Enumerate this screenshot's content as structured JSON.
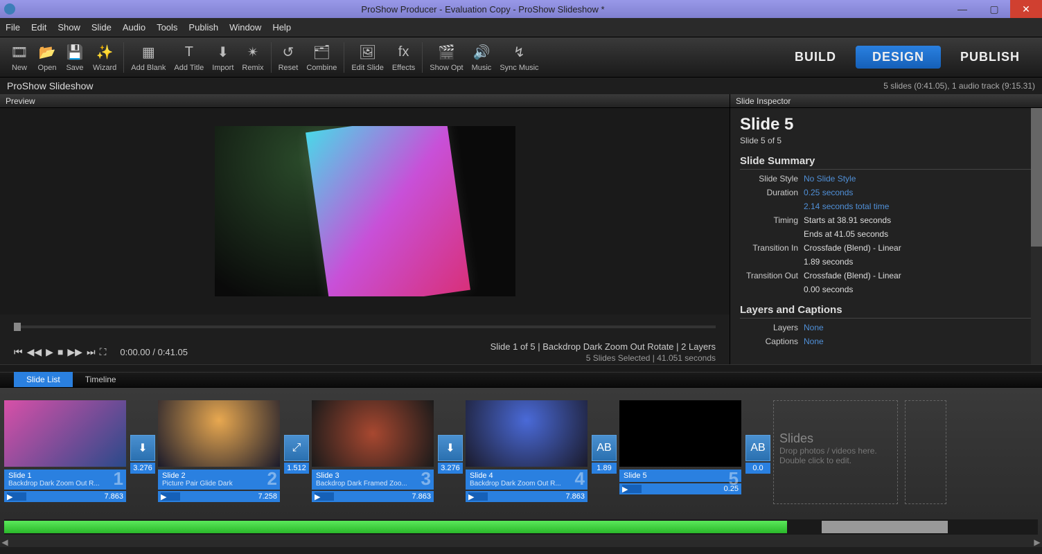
{
  "titlebar": "ProShow Producer - Evaluation Copy - ProShow Slideshow *",
  "menu": [
    "File",
    "Edit",
    "Show",
    "Slide",
    "Audio",
    "Tools",
    "Publish",
    "Window",
    "Help"
  ],
  "toolbar": [
    {
      "label": "New"
    },
    {
      "label": "Open"
    },
    {
      "label": "Save"
    },
    {
      "label": "Wizard"
    },
    {
      "label": "Add Blank"
    },
    {
      "label": "Add Title"
    },
    {
      "label": "Import"
    },
    {
      "label": "Remix"
    },
    {
      "label": "Reset"
    },
    {
      "label": "Combine"
    },
    {
      "label": "Edit Slide"
    },
    {
      "label": "Effects"
    },
    {
      "label": "Show Opt"
    },
    {
      "label": "Music"
    },
    {
      "label": "Sync Music"
    }
  ],
  "modes": {
    "build": "BUILD",
    "design": "DESIGN",
    "publish": "PUBLISH"
  },
  "shownamebar": {
    "name": "ProShow Slideshow",
    "summary": "5 slides (0:41.05), 1 audio track (9:15.31)"
  },
  "preview": {
    "title": "Preview",
    "time": "0:00.00 / 0:41.05",
    "info1": "Slide 1 of 5  |  Backdrop Dark Zoom Out Rotate  |  2 Layers",
    "info2": "5 Slides Selected  |  41.051 seconds"
  },
  "inspector": {
    "title": "Slide Inspector",
    "slideTitle": "Slide 5",
    "slideSub": "Slide 5 of 5",
    "summaryHdr": "Slide Summary",
    "rows": [
      {
        "lbl": "Slide Style",
        "val": "No Slide Style",
        "link": true
      },
      {
        "lbl": "Duration",
        "val": "0.25 seconds",
        "link": true
      },
      {
        "lbl": "",
        "val": "2.14 seconds total time",
        "link": true
      },
      {
        "lbl": "Timing",
        "val": "Starts at 38.91 seconds"
      },
      {
        "lbl": "",
        "val": "Ends at 41.05 seconds"
      },
      {
        "lbl": "Transition In",
        "val": "Crossfade (Blend) - Linear"
      },
      {
        "lbl": "",
        "val": "1.89 seconds"
      },
      {
        "lbl": "Transition Out",
        "val": "Crossfade (Blend) - Linear"
      },
      {
        "lbl": "",
        "val": "0.00 seconds"
      }
    ],
    "layersHdr": "Layers and Captions",
    "layersRows": [
      {
        "lbl": "Layers",
        "val": "None",
        "link": true
      },
      {
        "lbl": "Captions",
        "val": "None",
        "link": true
      }
    ]
  },
  "bottomtabs": {
    "slidelist": "Slide List",
    "timeline": "Timeline"
  },
  "slides": [
    {
      "name": "Slide 1",
      "effect": "Backdrop Dark Zoom Out R...",
      "dur": "7.863",
      "trans": "3.276",
      "transIco": "⬇"
    },
    {
      "name": "Slide 2",
      "effect": "Picture Pair Glide Dark",
      "dur": "7.258",
      "trans": "1.512",
      "transIco": "⤢"
    },
    {
      "name": "Slide 3",
      "effect": "Backdrop Dark Framed Zoo...",
      "dur": "7.863",
      "trans": "3.276",
      "transIco": "⬇"
    },
    {
      "name": "Slide 4",
      "effect": "Backdrop Dark Zoom Out R...",
      "dur": "7.863",
      "trans": "1.89",
      "transIco": "AB"
    },
    {
      "name": "Slide 5",
      "effect": "",
      "dur": "0.25",
      "trans": "0.0",
      "transIco": "AB"
    }
  ],
  "dropzone": {
    "title": "Slides",
    "line1": "Drop photos / videos here.",
    "line2": "Double click to edit."
  }
}
